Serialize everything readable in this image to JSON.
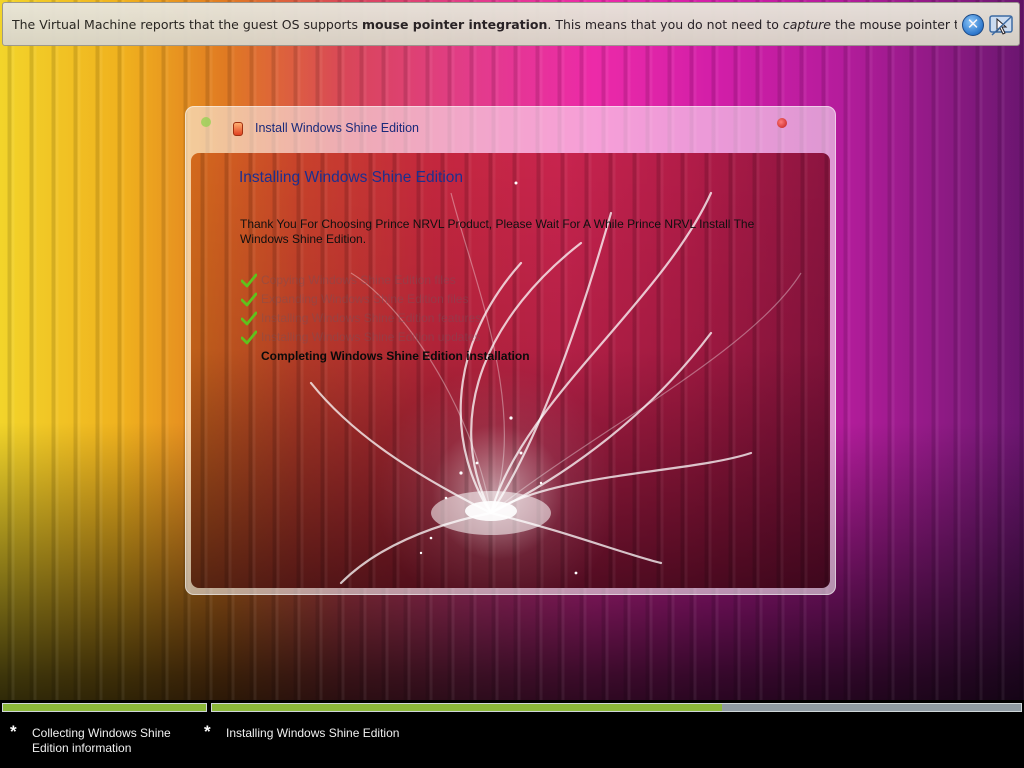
{
  "notification": {
    "text_before": "The Virtual Machine reports that the guest OS supports ",
    "bold_text": "mouse pointer integration",
    "text_middle": ". This means that you do not need to ",
    "italic_text": "capture",
    "text_after": " the mouse pointer to be able to use it in your",
    "close_icon": "close-icon",
    "pointer_icon": "mouse-pointer-integration-icon"
  },
  "window": {
    "title": "Install Windows Shine Edition",
    "heading": "Installing Windows Shine Edition",
    "intro": "Thank You For Choosing Prince NRVL Product, Please Wait For A While Prince NRVL Install The Windows Shine Edition.",
    "steps": [
      {
        "label": "Copying Windows Shine Edition files",
        "status": "done"
      },
      {
        "label": "Expanding Windows Shine Edition files",
        "status": "done"
      },
      {
        "label": "Installing Windows Shine Edition features",
        "status": "done"
      },
      {
        "label": "Installing Windows Shine Edition updates",
        "status": "done"
      },
      {
        "label": "Completing Windows Shine Edition installation",
        "status": "current"
      }
    ]
  },
  "progress": {
    "phases": [
      {
        "label": "Collecting Windows Shine Edition information",
        "progress": 1.0
      },
      {
        "label": "Installing Windows Shine Edition",
        "progress": 0.63
      }
    ]
  },
  "colors": {
    "progress_fill": "#8cb83a",
    "progress_track": "#8f9aa2",
    "heading": "#1c2f8f"
  }
}
